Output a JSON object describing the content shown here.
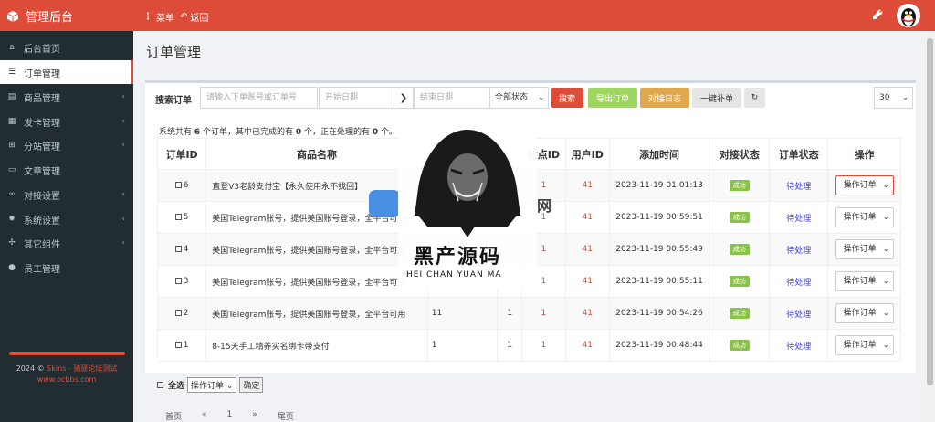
{
  "header": {
    "brand": "管理后台",
    "menu": "菜单",
    "back": "返回"
  },
  "sidebar": {
    "items": [
      {
        "label": "后台首页",
        "icon": "home-icon",
        "arrow": false
      },
      {
        "label": "订单管理",
        "icon": "list-icon",
        "arrow": false,
        "active": true
      },
      {
        "label": "商品管理",
        "icon": "cart-icon",
        "arrow": true
      },
      {
        "label": "发卡管理",
        "icon": "grid-icon",
        "arrow": true
      },
      {
        "label": "分站管理",
        "icon": "sitemap-icon",
        "arrow": true
      },
      {
        "label": "文章管理",
        "icon": "article-icon",
        "arrow": false
      },
      {
        "label": "对接设置",
        "icon": "link-icon",
        "arrow": true
      },
      {
        "label": "系统设置",
        "icon": "gear-icon",
        "arrow": true
      },
      {
        "label": "其它组件",
        "icon": "puzzle-icon",
        "arrow": true
      },
      {
        "label": "员工管理",
        "icon": "user-icon",
        "arrow": false
      }
    ],
    "copyright_line1_prefix": "2024 © ",
    "copyright_line1_link": "Skins - 骑驿论坛测试",
    "copyright_line2": "www.ocbbs.com"
  },
  "page": {
    "title": "订单管理"
  },
  "search": {
    "label": "搜索订单",
    "order_placeholder": "请输入下单账号或订单号",
    "start_placeholder": "开始日期",
    "end_placeholder": "结束日期",
    "status_value": "全部状态",
    "search_btn": "搜索",
    "export_btn": "导出订单",
    "log_btn": "对接日志",
    "resupply_btn": "一键补单",
    "page_size": "30"
  },
  "summary": {
    "p1": "系统共有 ",
    "total": "6",
    "p2": " 个订单，其中已完成的有 ",
    "done": "0",
    "p3": " 个，正在处理的有 ",
    "processing": "0",
    "p4": " 个。"
  },
  "table": {
    "headers": {
      "id": "订单ID",
      "name": "商品名称",
      "site": "站点ID",
      "user": "用户ID",
      "time": "添加时间",
      "dock": "对接状态",
      "status": "订单状态",
      "op": "操作"
    },
    "rows": [
      {
        "id": "6",
        "name": "直登V3老龄支付宝【永久使用永不找回】",
        "qty": "",
        "num": "",
        "site": "1",
        "user": "41",
        "time": "2023-11-19 01:01:13",
        "dock": "成功",
        "status": "待处理",
        "op": "操作订单"
      },
      {
        "id": "5",
        "name": "美国Telegram账号，提供美国账号登录，全平台可用",
        "qty": "",
        "num": "",
        "site": "1",
        "user": "41",
        "time": "2023-11-19 00:59:51",
        "dock": "成功",
        "status": "待处理",
        "op": "操作订单"
      },
      {
        "id": "4",
        "name": "美国Telegram账号，提供美国账号登录，全平台可用",
        "qty": "",
        "num": "",
        "site": "1",
        "user": "41",
        "time": "2023-11-19 00:55:49",
        "dock": "成功",
        "status": "待处理",
        "op": "操作订单"
      },
      {
        "id": "3",
        "name": "美国Telegram账号，提供美国账号登录，全平台可用",
        "qty": "",
        "num": "",
        "site": "1",
        "user": "41",
        "time": "2023-11-19 00:55:11",
        "dock": "成功",
        "status": "待处理",
        "op": "操作订单"
      },
      {
        "id": "2",
        "name": "美国Telegram账号，提供美国账号登录，全平台可用",
        "qty": "11",
        "num": "1",
        "site": "1",
        "user": "41",
        "time": "2023-11-19 00:54:26",
        "dock": "成功",
        "status": "待处理",
        "op": "操作订单"
      },
      {
        "id": "1",
        "name": "8-15天手工精养实名绑卡带支付",
        "qty": "1",
        "num": "1",
        "site": "1",
        "user": "41",
        "time": "2023-11-19 00:48:44",
        "dock": "成功",
        "status": "待处理",
        "op": "操作订单"
      }
    ]
  },
  "bulk": {
    "select_all": "全选",
    "action": "操作订单",
    "confirm": "确定"
  },
  "pager": {
    "first": "首页",
    "prev": "«",
    "current": "1",
    "next": "»",
    "last": "尾页"
  },
  "watermark": {
    "title": "黑产源码",
    "subtitle": "HEI CHAN YUAN MA",
    "suffix": "网"
  },
  "colors": {
    "primary": "#dd4b39",
    "sidebar": "#222d32",
    "success": "#8bc34a",
    "warning": "#e0a84c",
    "export": "#9fd65f"
  }
}
